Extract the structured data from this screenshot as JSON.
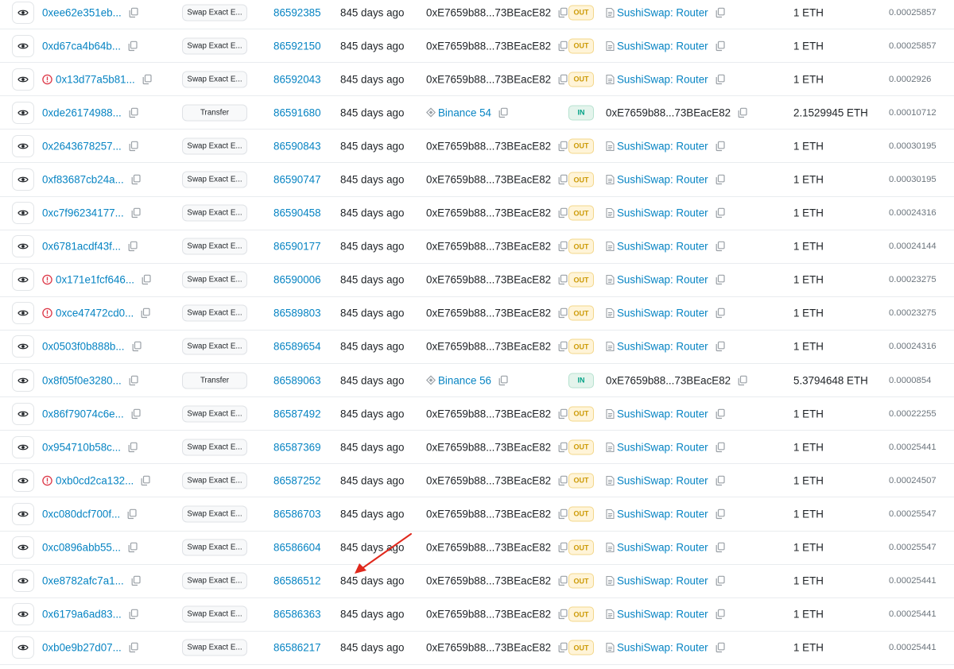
{
  "colors": {
    "link": "#0784c3",
    "out_bg": "#fff4d8",
    "out_text": "#cc9a06",
    "in_bg": "#e4f4ec",
    "in_text": "#00a186",
    "error": "#dc3545",
    "arrow": "#e0281c"
  },
  "icons": {
    "view": "eye-icon",
    "copy": "copy-icon",
    "error": "exclamation-circle-icon",
    "exchange": "diamond-icon",
    "contract": "file-icon"
  },
  "transactions": [
    {
      "hash": "0xee62e351eb...",
      "error": false,
      "method": "Swap Exact E...",
      "block": "86592385",
      "age": "845 days ago",
      "from": "0xE7659b88...73BEacE82",
      "from_is_exchange": false,
      "direction": "OUT",
      "to": "SushiSwap: Router",
      "to_is_contract": true,
      "value": "1 ETH",
      "fee": "0.00025857"
    },
    {
      "hash": "0xd67ca4b64b...",
      "error": false,
      "method": "Swap Exact E...",
      "block": "86592150",
      "age": "845 days ago",
      "from": "0xE7659b88...73BEacE82",
      "from_is_exchange": false,
      "direction": "OUT",
      "to": "SushiSwap: Router",
      "to_is_contract": true,
      "value": "1 ETH",
      "fee": "0.00025857"
    },
    {
      "hash": "0x13d77a5b81...",
      "error": true,
      "method": "Swap Exact E...",
      "block": "86592043",
      "age": "845 days ago",
      "from": "0xE7659b88...73BEacE82",
      "from_is_exchange": false,
      "direction": "OUT",
      "to": "SushiSwap: Router",
      "to_is_contract": true,
      "value": "1 ETH",
      "fee": "0.0002926"
    },
    {
      "hash": "0xde26174988...",
      "error": false,
      "method": "Transfer",
      "block": "86591680",
      "age": "845 days ago",
      "from": "Binance 54",
      "from_is_exchange": true,
      "direction": "IN",
      "to": "0xE7659b88...73BEacE82",
      "to_is_contract": false,
      "value": "2.1529945 ETH",
      "fee": "0.00010712"
    },
    {
      "hash": "0x2643678257...",
      "error": false,
      "method": "Swap Exact E...",
      "block": "86590843",
      "age": "845 days ago",
      "from": "0xE7659b88...73BEacE82",
      "from_is_exchange": false,
      "direction": "OUT",
      "to": "SushiSwap: Router",
      "to_is_contract": true,
      "value": "1 ETH",
      "fee": "0.00030195"
    },
    {
      "hash": "0xf83687cb24a...",
      "error": false,
      "method": "Swap Exact E...",
      "block": "86590747",
      "age": "845 days ago",
      "from": "0xE7659b88...73BEacE82",
      "from_is_exchange": false,
      "direction": "OUT",
      "to": "SushiSwap: Router",
      "to_is_contract": true,
      "value": "1 ETH",
      "fee": "0.00030195"
    },
    {
      "hash": "0xc7f96234177...",
      "error": false,
      "method": "Swap Exact E...",
      "block": "86590458",
      "age": "845 days ago",
      "from": "0xE7659b88...73BEacE82",
      "from_is_exchange": false,
      "direction": "OUT",
      "to": "SushiSwap: Router",
      "to_is_contract": true,
      "value": "1 ETH",
      "fee": "0.00024316"
    },
    {
      "hash": "0x6781acdf43f...",
      "error": false,
      "method": "Swap Exact E...",
      "block": "86590177",
      "age": "845 days ago",
      "from": "0xE7659b88...73BEacE82",
      "from_is_exchange": false,
      "direction": "OUT",
      "to": "SushiSwap: Router",
      "to_is_contract": true,
      "value": "1 ETH",
      "fee": "0.00024144"
    },
    {
      "hash": "0x171e1fcf646...",
      "error": true,
      "method": "Swap Exact E...",
      "block": "86590006",
      "age": "845 days ago",
      "from": "0xE7659b88...73BEacE82",
      "from_is_exchange": false,
      "direction": "OUT",
      "to": "SushiSwap: Router",
      "to_is_contract": true,
      "value": "1 ETH",
      "fee": "0.00023275"
    },
    {
      "hash": "0xce47472cd0...",
      "error": true,
      "method": "Swap Exact E...",
      "block": "86589803",
      "age": "845 days ago",
      "from": "0xE7659b88...73BEacE82",
      "from_is_exchange": false,
      "direction": "OUT",
      "to": "SushiSwap: Router",
      "to_is_contract": true,
      "value": "1 ETH",
      "fee": "0.00023275"
    },
    {
      "hash": "0x0503f0b888b...",
      "error": false,
      "method": "Swap Exact E...",
      "block": "86589654",
      "age": "845 days ago",
      "from": "0xE7659b88...73BEacE82",
      "from_is_exchange": false,
      "direction": "OUT",
      "to": "SushiSwap: Router",
      "to_is_contract": true,
      "value": "1 ETH",
      "fee": "0.00024316"
    },
    {
      "hash": "0x8f05f0e3280...",
      "error": false,
      "method": "Transfer",
      "block": "86589063",
      "age": "845 days ago",
      "from": "Binance 56",
      "from_is_exchange": true,
      "direction": "IN",
      "to": "0xE7659b88...73BEacE82",
      "to_is_contract": false,
      "value": "5.3794648 ETH",
      "fee": "0.0000854"
    },
    {
      "hash": "0x86f79074c6e...",
      "error": false,
      "method": "Swap Exact E...",
      "block": "86587492",
      "age": "845 days ago",
      "from": "0xE7659b88...73BEacE82",
      "from_is_exchange": false,
      "direction": "OUT",
      "to": "SushiSwap: Router",
      "to_is_contract": true,
      "value": "1 ETH",
      "fee": "0.00022255"
    },
    {
      "hash": "0x954710b58c...",
      "error": false,
      "method": "Swap Exact E...",
      "block": "86587369",
      "age": "845 days ago",
      "from": "0xE7659b88...73BEacE82",
      "from_is_exchange": false,
      "direction": "OUT",
      "to": "SushiSwap: Router",
      "to_is_contract": true,
      "value": "1 ETH",
      "fee": "0.00025441"
    },
    {
      "hash": "0xb0cd2ca132...",
      "error": true,
      "method": "Swap Exact E...",
      "block": "86587252",
      "age": "845 days ago",
      "from": "0xE7659b88...73BEacE82",
      "from_is_exchange": false,
      "direction": "OUT",
      "to": "SushiSwap: Router",
      "to_is_contract": true,
      "value": "1 ETH",
      "fee": "0.00024507"
    },
    {
      "hash": "0xc080dcf700f...",
      "error": false,
      "method": "Swap Exact E...",
      "block": "86586703",
      "age": "845 days ago",
      "from": "0xE7659b88...73BEacE82",
      "from_is_exchange": false,
      "direction": "OUT",
      "to": "SushiSwap: Router",
      "to_is_contract": true,
      "value": "1 ETH",
      "fee": "0.00025547"
    },
    {
      "hash": "0xc0896abb55...",
      "error": false,
      "method": "Swap Exact E...",
      "block": "86586604",
      "age": "845 days ago",
      "from": "0xE7659b88...73BEacE82",
      "from_is_exchange": false,
      "direction": "OUT",
      "to": "SushiSwap: Router",
      "to_is_contract": true,
      "value": "1 ETH",
      "fee": "0.00025547"
    },
    {
      "hash": "0xe8782afc7a1...",
      "error": false,
      "method": "Swap Exact E...",
      "block": "86586512",
      "age": "845 days ago",
      "from": "0xE7659b88...73BEacE82",
      "from_is_exchange": false,
      "direction": "OUT",
      "to": "SushiSwap: Router",
      "to_is_contract": true,
      "value": "1 ETH",
      "fee": "0.00025441"
    },
    {
      "hash": "0x6179a6ad83...",
      "error": false,
      "method": "Swap Exact E...",
      "block": "86586363",
      "age": "845 days ago",
      "from": "0xE7659b88...73BEacE82",
      "from_is_exchange": false,
      "direction": "OUT",
      "to": "SushiSwap: Router",
      "to_is_contract": true,
      "value": "1 ETH",
      "fee": "0.00025441"
    },
    {
      "hash": "0xb0e9b27d07...",
      "error": false,
      "method": "Swap Exact E...",
      "block": "86586217",
      "age": "845 days ago",
      "from": "0xE7659b88...73BEacE82",
      "from_is_exchange": false,
      "direction": "OUT",
      "to": "SushiSwap: Router",
      "to_is_contract": true,
      "value": "1 ETH",
      "fee": "0.00025441"
    }
  ]
}
